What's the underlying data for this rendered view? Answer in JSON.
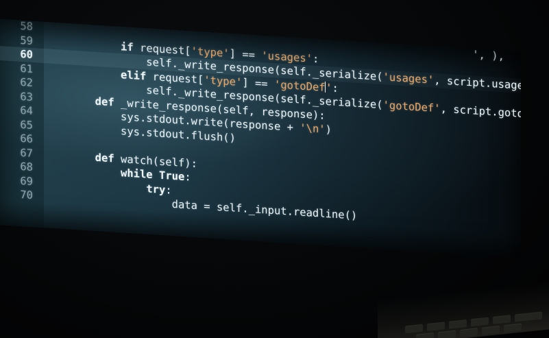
{
  "editor": {
    "lines": [
      {
        "num": "58",
        "segments": [
          {
            "t": "                                                                   ', ",
            "c": "op"
          },
          {
            "t": "),",
            "c": "op"
          }
        ]
      },
      {
        "num": "59",
        "segments": [
          {
            "t": "            ",
            "c": "op"
          },
          {
            "t": "if",
            "c": "kw"
          },
          {
            "t": " request[",
            "c": "fn"
          },
          {
            "t": "'type'",
            "c": "str"
          },
          {
            "t": "] == ",
            "c": "op"
          },
          {
            "t": "'usages'",
            "c": "str"
          },
          {
            "t": ":",
            "c": "op"
          }
        ]
      },
      {
        "num": "60",
        "current": true,
        "segments": [
          {
            "t": "                self._write_response(self._serialize(",
            "c": "fn"
          },
          {
            "t": "'usages'",
            "c": "str"
          },
          {
            "t": ", script.usages()))",
            "c": "fn"
          }
        ]
      },
      {
        "num": "61",
        "segments": [
          {
            "t": "            ",
            "c": "op"
          },
          {
            "t": "elif",
            "c": "kw"
          },
          {
            "t": " request[",
            "c": "fn"
          },
          {
            "t": "'type'",
            "c": "str"
          },
          {
            "t": "] == ",
            "c": "op"
          },
          {
            "t": "'gotoDef",
            "c": "str"
          },
          {
            "t": "|",
            "c": "cursor"
          },
          {
            "t": "'",
            "c": "str"
          },
          {
            "t": ":",
            "c": "op"
          }
        ]
      },
      {
        "num": "62",
        "segments": [
          {
            "t": "                self._write_response(self._serialize(",
            "c": "fn"
          },
          {
            "t": "'gotoDef'",
            "c": "str"
          },
          {
            "t": ", script.goto_definitions()))",
            "c": "fn"
          }
        ]
      },
      {
        "num": "63",
        "segments": [
          {
            "t": "        ",
            "c": "op"
          },
          {
            "t": "def",
            "c": "kw"
          },
          {
            "t": " _write_response(self, response):",
            "c": "fn"
          }
        ]
      },
      {
        "num": "64",
        "segments": [
          {
            "t": "            sys.stdout.write(response + ",
            "c": "fn"
          },
          {
            "t": "'\\n'",
            "c": "str"
          },
          {
            "t": ")",
            "c": "fn"
          }
        ]
      },
      {
        "num": "65",
        "segments": [
          {
            "t": "            sys.stdout.flush()",
            "c": "fn"
          }
        ]
      },
      {
        "num": "66",
        "segments": [
          {
            "t": "",
            "c": "fn"
          }
        ]
      },
      {
        "num": "67",
        "segments": [
          {
            "t": "        ",
            "c": "op"
          },
          {
            "t": "def",
            "c": "kw"
          },
          {
            "t": " watch(self):",
            "c": "fn"
          }
        ]
      },
      {
        "num": "68",
        "segments": [
          {
            "t": "            ",
            "c": "op"
          },
          {
            "t": "while",
            "c": "kw"
          },
          {
            "t": " ",
            "c": "op"
          },
          {
            "t": "True",
            "c": "kw"
          },
          {
            "t": ":",
            "c": "op"
          }
        ]
      },
      {
        "num": "69",
        "segments": [
          {
            "t": "                ",
            "c": "op"
          },
          {
            "t": "try",
            "c": "kw"
          },
          {
            "t": ":",
            "c": "op"
          }
        ]
      },
      {
        "num": "70",
        "segments": [
          {
            "t": "                    data = self._input.readline()",
            "c": "fn"
          }
        ]
      }
    ]
  },
  "colors": {
    "keyword": "#f1f6f8",
    "string": "#f0a45e",
    "line_number": "#8ea3ab",
    "text": "#e6eef2"
  }
}
